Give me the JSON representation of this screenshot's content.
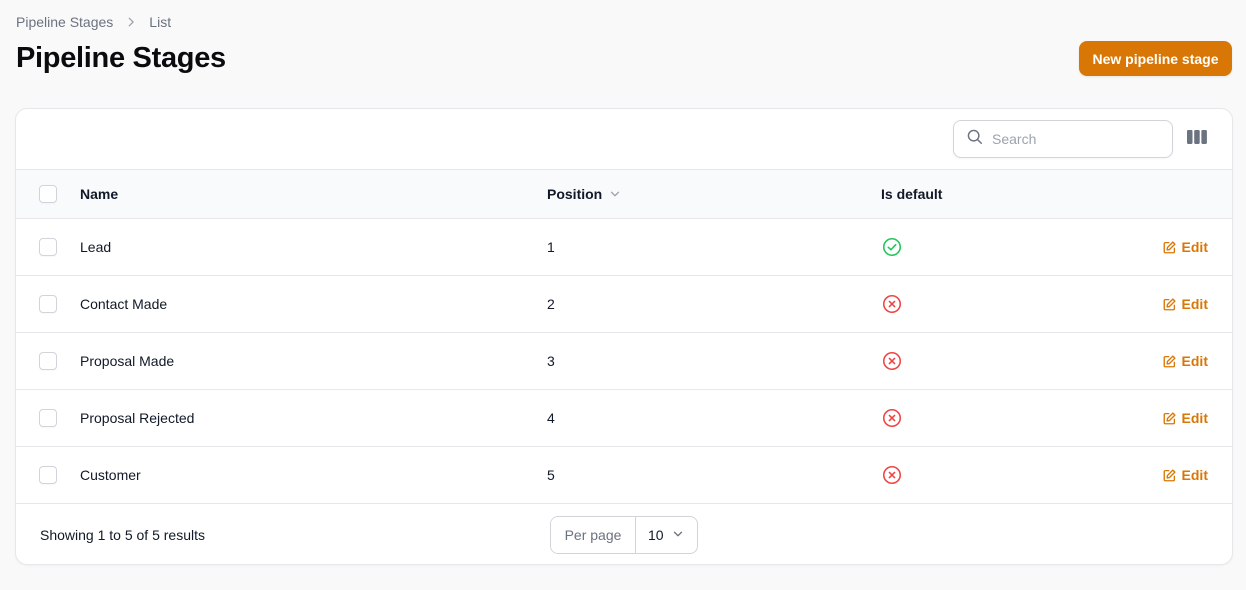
{
  "breadcrumb": {
    "items": [
      "Pipeline Stages",
      "List"
    ]
  },
  "page": {
    "title": "Pipeline Stages",
    "new_button_label": "New pipeline stage"
  },
  "search": {
    "placeholder": "Search",
    "value": ""
  },
  "table": {
    "columns": {
      "name": "Name",
      "position": "Position",
      "is_default": "Is default"
    },
    "rows": [
      {
        "name": "Lead",
        "position": "1",
        "is_default": true,
        "action": "Edit"
      },
      {
        "name": "Contact Made",
        "position": "2",
        "is_default": false,
        "action": "Edit"
      },
      {
        "name": "Proposal Made",
        "position": "3",
        "is_default": false,
        "action": "Edit"
      },
      {
        "name": "Proposal Rejected",
        "position": "4",
        "is_default": false,
        "action": "Edit"
      },
      {
        "name": "Customer",
        "position": "5",
        "is_default": false,
        "action": "Edit"
      }
    ]
  },
  "footer": {
    "showing": "Showing 1 to 5 of 5 results",
    "per_page_label": "Per page",
    "per_page_value": "10"
  },
  "colors": {
    "accent": "#d97706",
    "success": "#22c55e",
    "danger": "#ef4444"
  },
  "icons": {
    "breadcrumb_separator": "chevron-right-icon",
    "search": "search-icon",
    "columns": "columns-icon",
    "sort": "chevron-down-icon",
    "true": "check-circle-icon",
    "false": "x-circle-icon",
    "edit": "pencil-square-icon"
  }
}
